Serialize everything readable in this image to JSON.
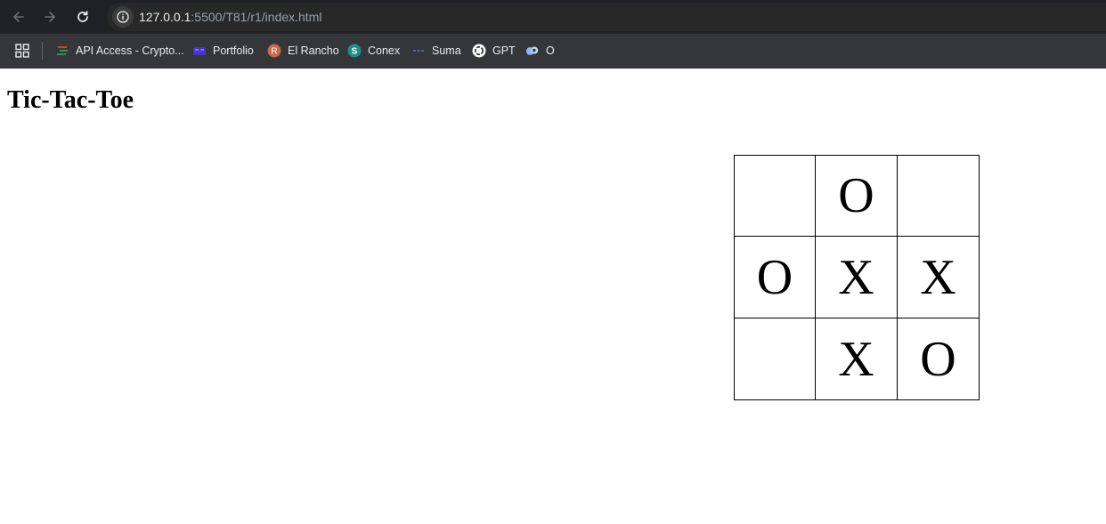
{
  "browser": {
    "url_host": "127.0.0.1",
    "url_rest": ":5500/T81/r1/index.html",
    "bookmarks": [
      {
        "label": "API Access - Crypto...",
        "icon": "stacked-lines-icon",
        "color": "#e8453c"
      },
      {
        "label": "Portfolio",
        "icon": "portfolio-icon",
        "color": "#5b3fd6"
      },
      {
        "label": "El Rancho",
        "icon": "letter-r-icon",
        "color": "#c8694a"
      },
      {
        "label": "Conex",
        "icon": "letter-s-icon",
        "color": "#1e8e8a"
      },
      {
        "label": "Suma",
        "icon": "dash-icon",
        "color": "#1a73e8"
      },
      {
        "label": "GPT",
        "icon": "openai-icon",
        "color": "#ffffff"
      },
      {
        "label": "O",
        "icon": "blob-icon",
        "color": "#8ab4f8"
      }
    ]
  },
  "page": {
    "title": "Tic-Tac-Toe"
  },
  "board": {
    "cells": [
      "",
      "O",
      "",
      "O",
      "X",
      "X",
      "",
      "X",
      "O"
    ]
  }
}
